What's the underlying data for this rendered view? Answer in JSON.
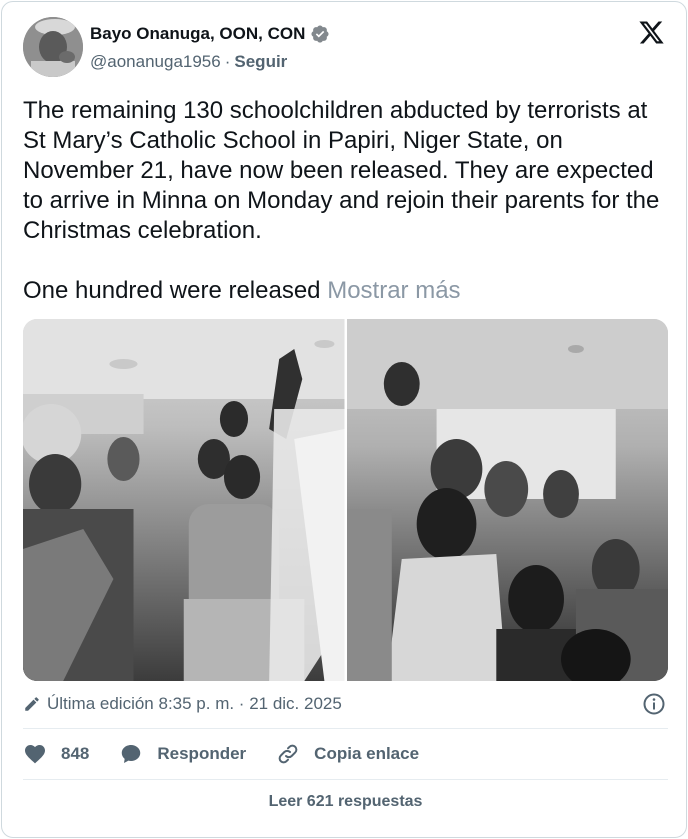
{
  "author": {
    "name": "Bayo Onanuga, OON, CON",
    "handle": "@aonanuga1956",
    "separator": "·",
    "follow_label": "Seguir"
  },
  "icons": {
    "verified": "verified-badge-icon",
    "logo": "x-logo-icon",
    "edit": "pencil-icon",
    "info": "info-icon",
    "like": "heart-icon",
    "reply": "speech-bubble-icon",
    "link": "link-icon"
  },
  "tweet": {
    "text": "The remaining 130 schoolchildren abducted by terrorists at St Mary’s Catholic School in Papiri, Niger State, on November 21, have now been released. They are expected to arrive in Minna on Monday and rejoin their parents for the Christmas celebration.",
    "second_paragraph": "One hundred were released",
    "show_more": "Mostrar más"
  },
  "meta": {
    "edited_label": "Última edición 8:35 p. m. · 21 dic. 2025"
  },
  "actions": {
    "likes_count": "848",
    "reply_label": "Responder",
    "copy_link_label": "Copia enlace"
  },
  "footer": {
    "read_replies_label": "Leer 621 respuestas"
  },
  "colors": {
    "text": "#0f1419",
    "muted": "#536471",
    "border": "#cfd9de"
  }
}
